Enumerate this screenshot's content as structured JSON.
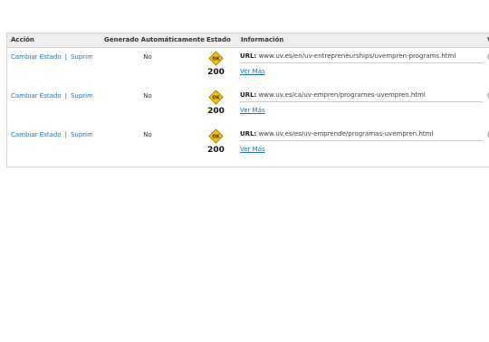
{
  "table": {
    "headers": {
      "accion": "Acción",
      "generado": "Generado Automáticamente",
      "estado": "Estado",
      "informacion": "Información",
      "extra": "V"
    },
    "rows": [
      {
        "change_state": "Cambiar Estado",
        "separator": "|",
        "delete": "Suprimir",
        "auto_generated": "No",
        "status_icon_text": "OK",
        "status_code": "200",
        "url_label": "URL:",
        "url": "www.uv.es/en/uv-entrepreneurships/uvempren-programs.html",
        "more": "Ver Más",
        "edge": "("
      },
      {
        "change_state": "Cambiar Estado",
        "separator": "|",
        "delete": "Suprimir",
        "auto_generated": "No",
        "status_icon_text": "OK",
        "status_code": "200",
        "url_label": "URL:",
        "url": "www.uv.es/ca/uv-empren/programes-uvempren.html",
        "more": "Ver Más",
        "edge": "("
      },
      {
        "change_state": "Cambiar Estado",
        "separator": "|",
        "delete": "Suprimir",
        "auto_generated": "No",
        "status_icon_text": "OK",
        "status_code": "200",
        "url_label": "URL:",
        "url": "www.uv.es/es/uv-emprende/programas-uvempren.html",
        "more": "Ver Más",
        "edge": "("
      }
    ]
  },
  "colors": {
    "link": "#1a75b8",
    "ok_icon_fill": "#f2c200",
    "header_bg": "#eeeeee"
  },
  "icons": {
    "status": "ok-diamond-icon"
  }
}
